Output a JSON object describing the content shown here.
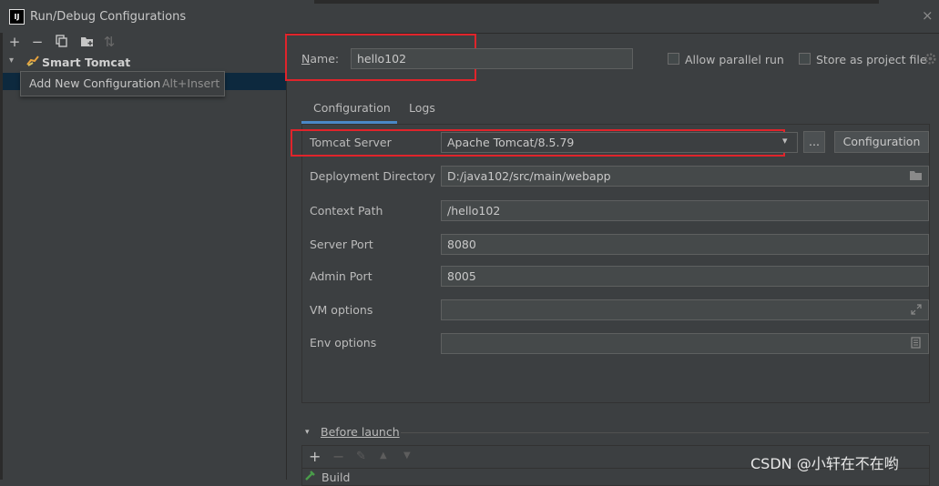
{
  "window": {
    "title": "Run/Debug Configurations",
    "app_icon_text": "IJ",
    "close_glyph": "×"
  },
  "left_toolbar": {
    "add": "+",
    "remove": "−",
    "copy": "⧉",
    "folder": "▰",
    "sort": "⇅"
  },
  "tree": {
    "arrow": "▾",
    "group_label": "Smart Tomcat",
    "icon": "cat-icon"
  },
  "tooltip": {
    "label": "Add New Configuration",
    "shortcut": "Alt+Insert"
  },
  "form": {
    "name_label": "Name:",
    "name_value": "hello102",
    "allow_parallel_run": {
      "label": "Allow parallel run",
      "checked": false
    },
    "store_as_project_file": {
      "label": "Store as project file",
      "checked": false
    }
  },
  "tabs": [
    {
      "label": "Configuration",
      "active": true
    },
    {
      "label": "Logs",
      "active": false
    }
  ],
  "config": {
    "tomcat_server": {
      "label": "Tomcat Server",
      "value": "Apache Tomcat/8.5.79",
      "dropdown_glyph": "▾",
      "browse_label": "...",
      "configure_label": "Configuration"
    },
    "deployment_directory": {
      "label": "Deployment Directory",
      "value": "D:/java102/src/main/webapp"
    },
    "context_path": {
      "label": "Context Path",
      "value": "/hello102"
    },
    "server_port": {
      "label": "Server Port",
      "value": "8080"
    },
    "admin_port": {
      "label": "Admin Port",
      "value": "8005"
    },
    "vm_options": {
      "label": "VM options",
      "value": ""
    },
    "env_options": {
      "label": "Env options",
      "value": ""
    }
  },
  "before_launch": {
    "arrow": "▾",
    "label": "Before launch",
    "toolbar": {
      "add": "+",
      "remove": "−",
      "edit": "✎",
      "up": "▲",
      "down": "▼"
    },
    "items": [
      {
        "label": "Build"
      }
    ]
  },
  "watermark": "CSDN @小轩在不在哟",
  "colors": {
    "background": "#3c3f41",
    "selection": "#0d293e",
    "tab_underline": "#4a88c7",
    "highlight_box": "#e0242b"
  }
}
